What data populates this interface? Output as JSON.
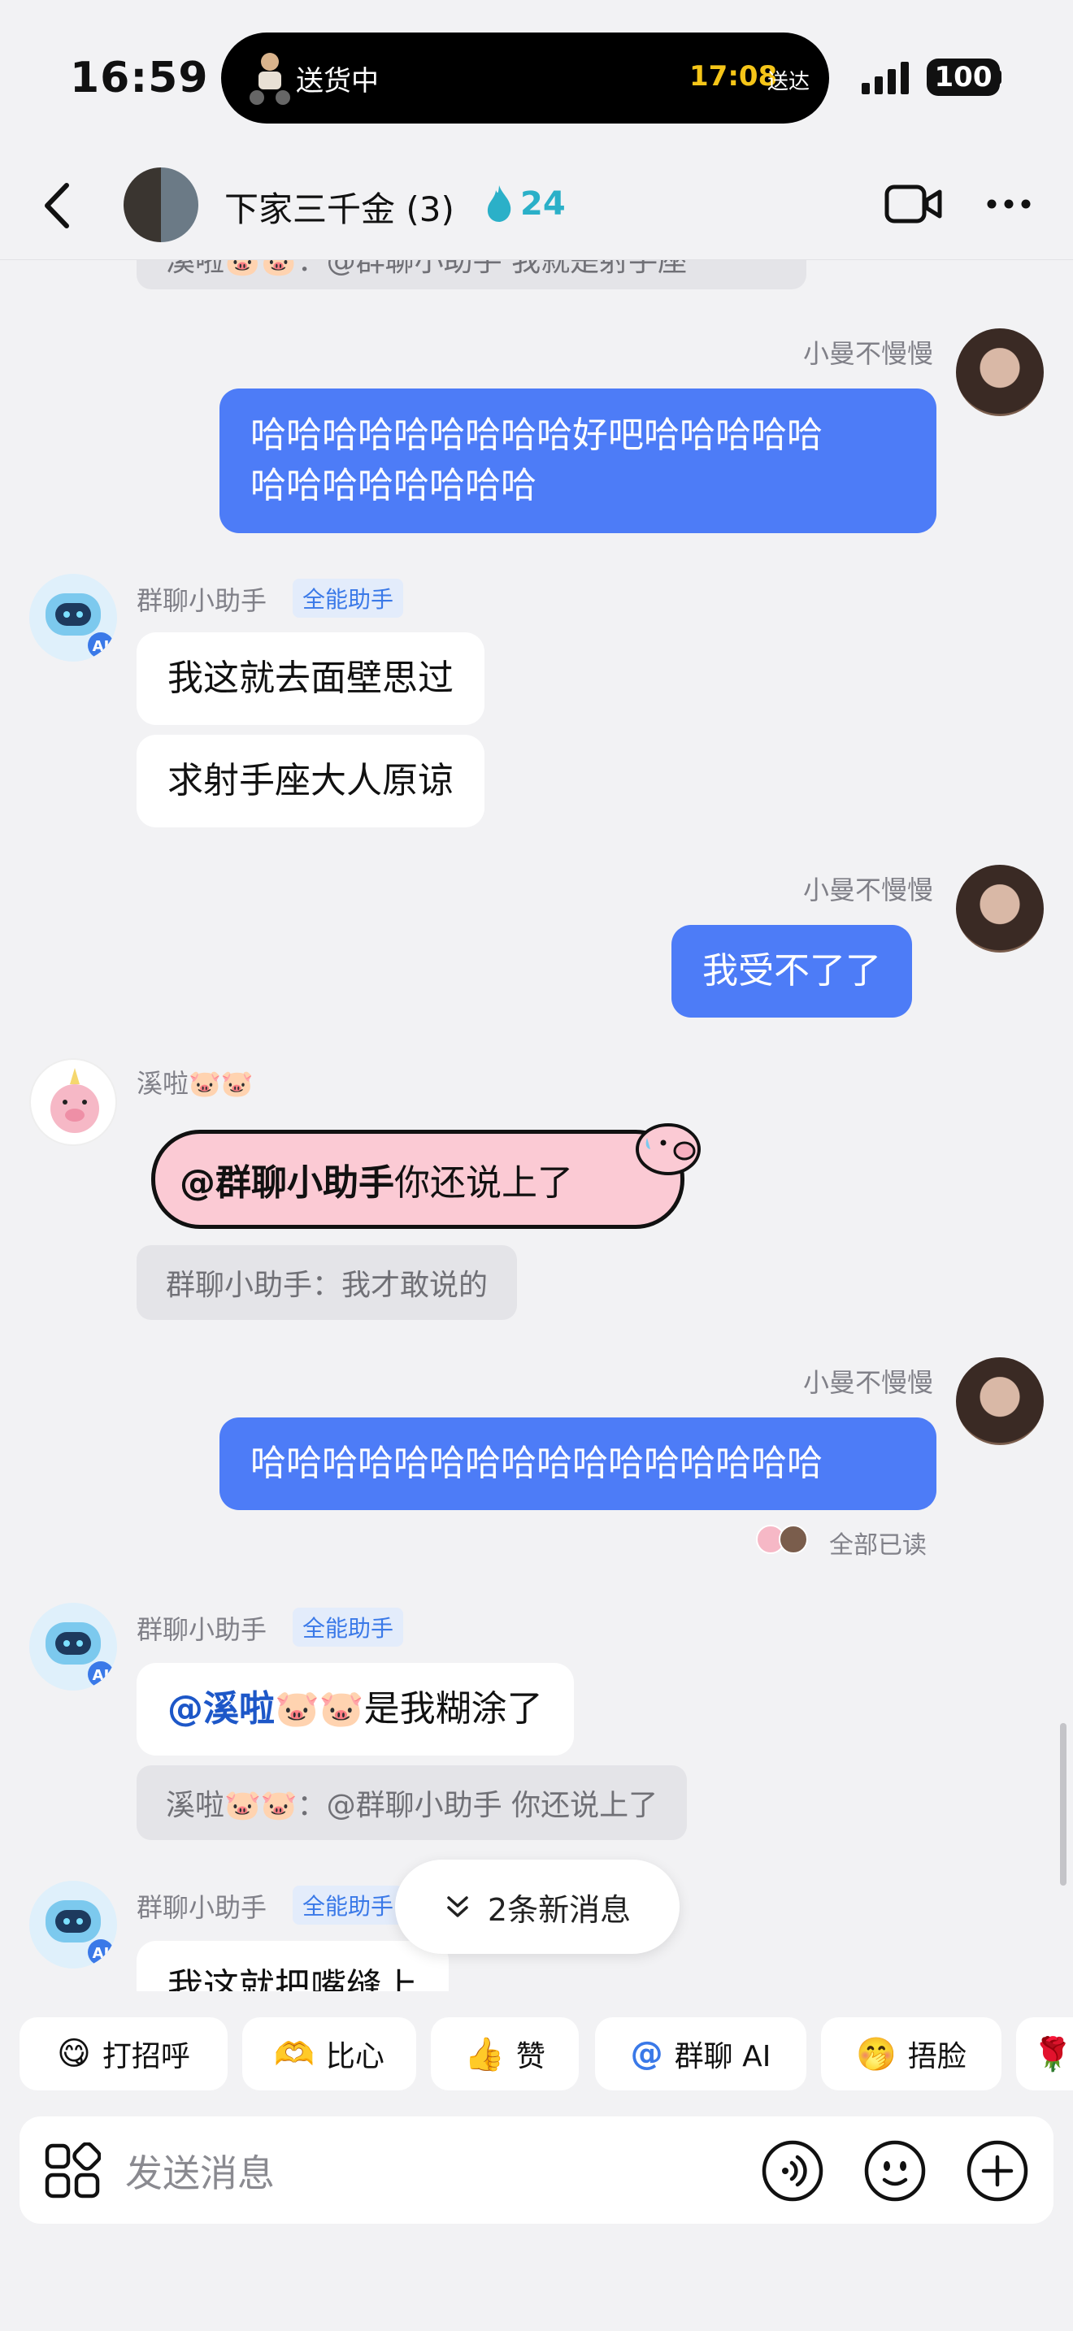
{
  "status_bar": {
    "time": "16:59",
    "island_label": "送货中",
    "island_eta": "17:08",
    "island_eta_suffix": "送达",
    "battery": "100"
  },
  "header": {
    "title": "下家三千金 (3)",
    "streak_count": "24"
  },
  "messages": {
    "partial_quote": "溪啦🐷🐷：@群聊小助手 我就是射手座",
    "m1_sender": "小曼不慢慢",
    "m1_text_line1": "哈哈哈哈哈哈哈哈哈好吧哈哈哈哈哈",
    "m1_text_line2": "哈哈哈哈哈哈哈哈",
    "m2_sender": "群聊小助手",
    "m2_tag": "全能助手",
    "m2_text_a": "我这就去面壁思过",
    "m2_text_b": "求射手座大人原谅",
    "m3_sender": "小曼不慢慢",
    "m3_text": "我受不了了",
    "m4_sender": "溪啦🐷🐷",
    "m4_sticker_mention": "@群聊小助手",
    "m4_sticker_text": " 你还说上了",
    "m4_quote": "群聊小助手：我才敢说的",
    "m5_sender": "小曼不慢慢",
    "m5_text": "哈哈哈哈哈哈哈哈哈哈哈哈哈哈哈哈",
    "m5_read": "全部已读",
    "m6_sender": "群聊小助手",
    "m6_tag": "全能助手",
    "m6_mention": "@溪啦🐷🐷",
    "m6_text": " 是我糊涂了",
    "m6_quote": "溪啦🐷🐷：@群聊小助手 你还说上了",
    "m7_sender": "群聊小助手",
    "m7_tag": "全能助手",
    "m7_text": "我这就把嘴缝上"
  },
  "new_messages_pill": "2条新消息",
  "quick_replies": [
    {
      "emoji": "😋",
      "label": "打招呼"
    },
    {
      "emoji": "🫶",
      "label": "比心"
    },
    {
      "emoji": "👍",
      "label": "赞"
    },
    {
      "emoji": "@",
      "label": "群聊 AI"
    },
    {
      "emoji": "🤭",
      "label": "捂脸"
    },
    {
      "emoji": "🌹",
      "label": ""
    }
  ],
  "input": {
    "placeholder": "发送消息"
  },
  "colors": {
    "bubble_blue": "#4d7cf7",
    "tag_blue": "#3a79e8",
    "streak_teal": "#2bb0c8",
    "sticker_pink": "#fbcad4"
  }
}
